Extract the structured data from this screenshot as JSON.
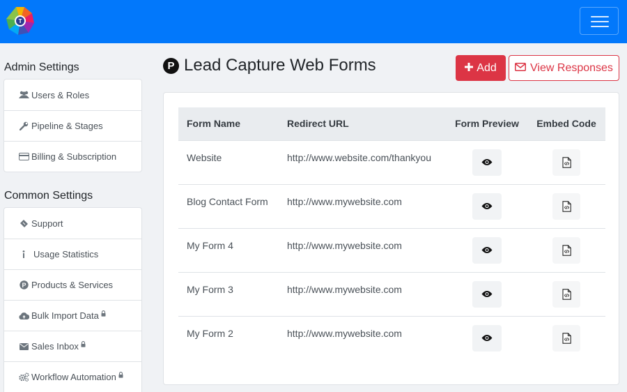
{
  "navbar": {
    "logo_icon": "app-logo-icon",
    "menu_icon": "hamburger-icon",
    "brand_color": "#0278fb"
  },
  "sidebar": {
    "admin_heading": "Admin Settings",
    "admin_items": [
      {
        "label": "Users & Roles",
        "icon": "users-icon"
      },
      {
        "label": "Pipeline & Stages",
        "icon": "wrench-icon"
      },
      {
        "label": "Billing & Subscription",
        "icon": "credit-card-icon"
      }
    ],
    "common_heading": "Common Settings",
    "common_items": [
      {
        "label": "Support",
        "icon": "ticket-icon",
        "locked": false
      },
      {
        "label": "Usage Statistics",
        "icon": "info-icon",
        "locked": false
      },
      {
        "label": "Products & Services",
        "icon": "product-icon",
        "locked": false
      },
      {
        "label": "Bulk Import Data",
        "icon": "cloud-upload-icon",
        "locked": true
      },
      {
        "label": "Sales Inbox",
        "icon": "envelope-icon",
        "locked": true
      },
      {
        "label": "Workflow Automation",
        "icon": "cogs-icon",
        "locked": true
      }
    ]
  },
  "main": {
    "title_badge": "P",
    "title": "Lead Capture Web Forms",
    "add_label": "Add",
    "view_responses_label": "View Responses",
    "accent_color": "#dc3545",
    "table": {
      "headers": [
        "Form Name",
        "Redirect URL",
        "Form Preview",
        "Embed Code"
      ],
      "rows": [
        {
          "name": "Website",
          "url": "http://www.website.com/thankyou"
        },
        {
          "name": "Blog Contact Form",
          "url": "http://www.mywebsite.com"
        },
        {
          "name": "My Form 4",
          "url": "http://www.mywebsite.com"
        },
        {
          "name": "My Form 3",
          "url": "http://www.mywebsite.com"
        },
        {
          "name": "My Form 2",
          "url": "http://www.mywebsite.com"
        }
      ]
    }
  }
}
